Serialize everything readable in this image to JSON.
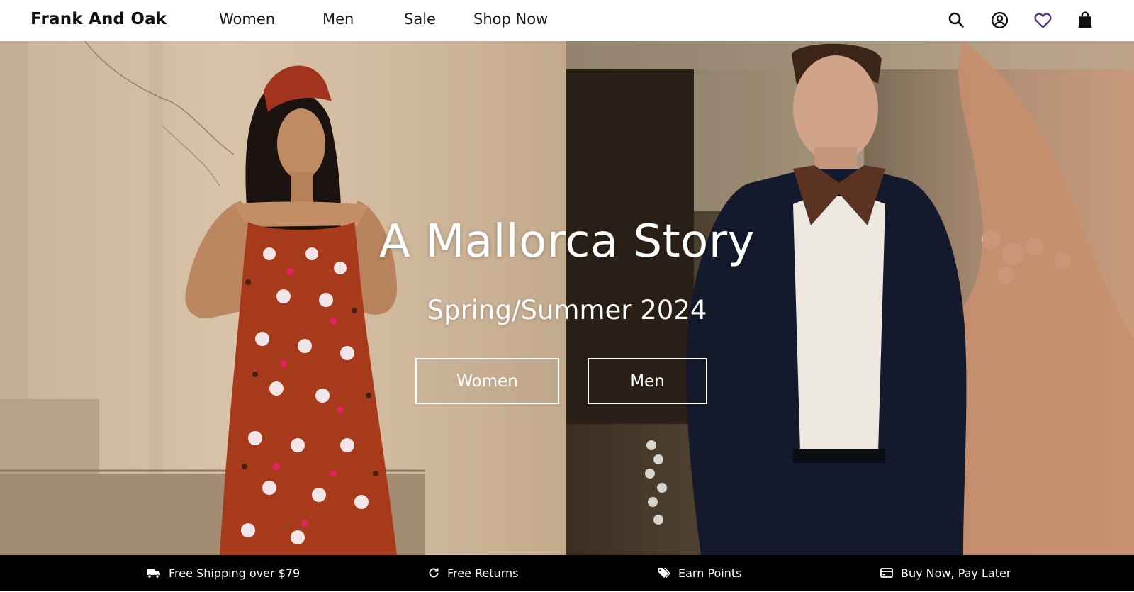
{
  "header": {
    "logo": "Frank And Oak",
    "nav": [
      "Women",
      "Men",
      "Sale",
      "Shop Now"
    ],
    "icons": [
      "search-icon",
      "account-icon",
      "heart-icon",
      "bag-icon"
    ],
    "heart_color": "#5b2a86"
  },
  "hero": {
    "title": "A Mallorca Story",
    "subtitle": "Spring/Summer 2024",
    "buttons": [
      "Women",
      "Men"
    ]
  },
  "perks": [
    {
      "icon": "truck-icon",
      "label": "Free Shipping over $79"
    },
    {
      "icon": "refresh-icon",
      "label": "Free Returns"
    },
    {
      "icon": "tags-icon",
      "label": "Earn Points"
    },
    {
      "icon": "credit-card-icon",
      "label": "Buy Now, Pay Later"
    }
  ]
}
